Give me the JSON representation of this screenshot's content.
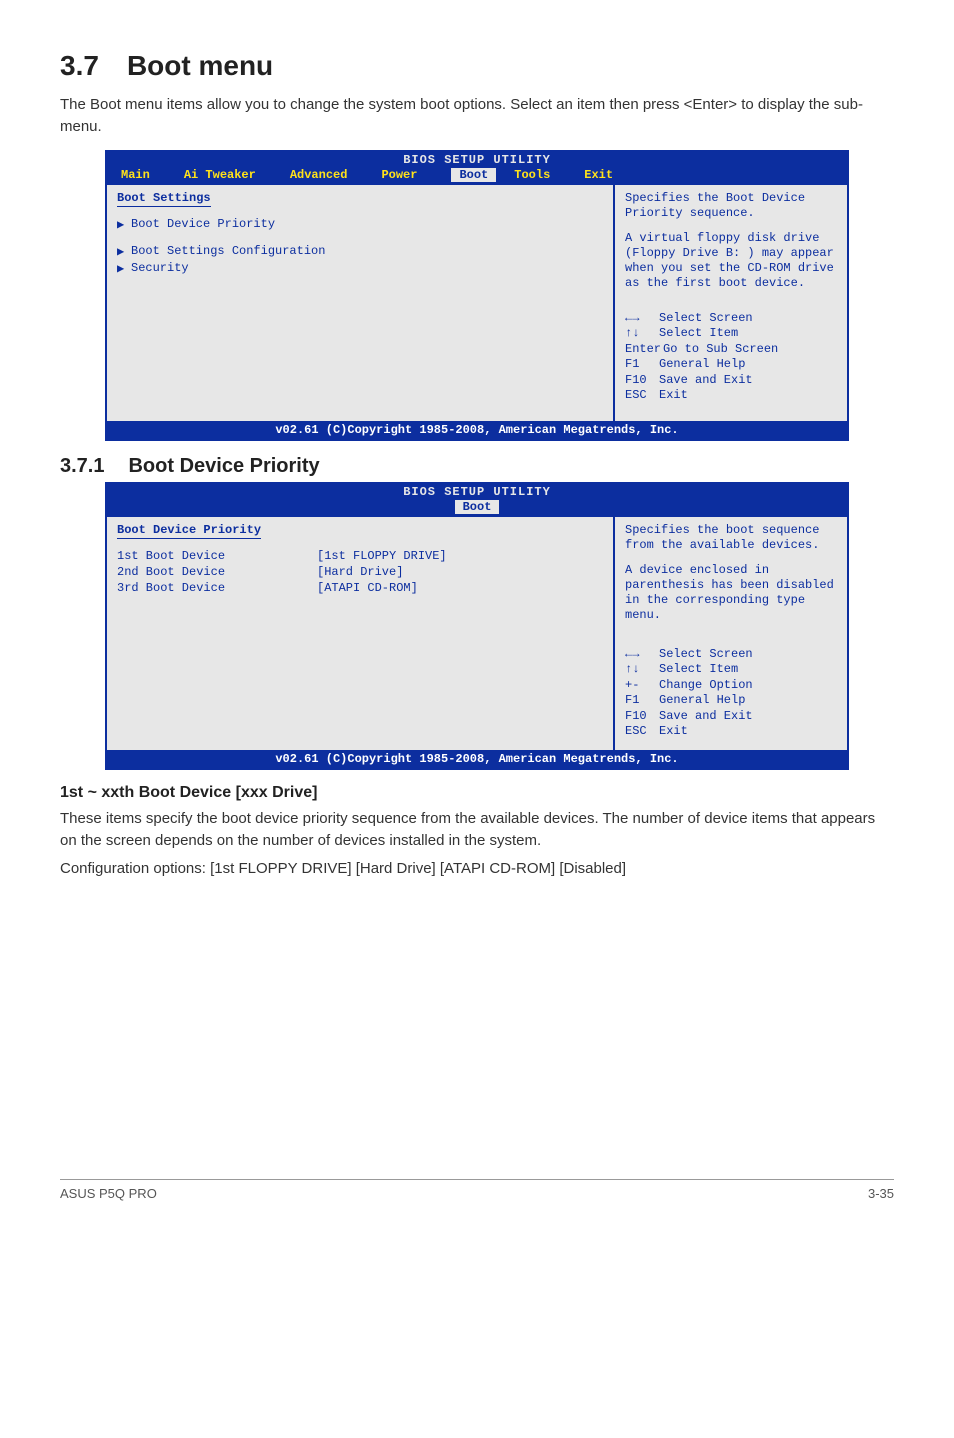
{
  "section": {
    "number": "3.7",
    "title": "Boot menu"
  },
  "intro": "The Boot menu items allow you to change the system boot options. Select an item then press <Enter> to display the sub-menu.",
  "bios1": {
    "title": "BIOS SETUP UTILITY",
    "tabs": [
      "Main",
      "Ai Tweaker",
      "Advanced",
      "Power",
      "Boot",
      "Tools",
      "Exit"
    ],
    "active_tab": "Boot",
    "heading": "Boot Settings",
    "items": [
      "Boot Device Priority",
      "Boot Settings Configuration",
      "Security"
    ],
    "help1": "Specifies the Boot Device Priority sequence.",
    "help2": "A virtual floppy disk drive (Floppy Drive B: ) may appear when you set the CD-ROM drive as the first boot device.",
    "keys": [
      {
        "glyph": "←→",
        "text": "Select Screen"
      },
      {
        "glyph": "↑↓",
        "text": "Select Item"
      },
      {
        "glyph": "Enter",
        "text": "Go to Sub Screen"
      },
      {
        "glyph": "F1",
        "text": "General Help"
      },
      {
        "glyph": "F10",
        "text": "Save and Exit"
      },
      {
        "glyph": "ESC",
        "text": "Exit"
      }
    ],
    "footer": "v02.61 (C)Copyright 1985-2008, American Megatrends, Inc."
  },
  "subsection": {
    "number": "3.7.1",
    "title": "Boot Device Priority"
  },
  "bios2": {
    "title": "BIOS SETUP UTILITY",
    "active_tab_only": "Boot",
    "heading": "Boot Device Priority",
    "rows": [
      {
        "label": "1st Boot Device",
        "value": "[1st FLOPPY DRIVE]"
      },
      {
        "label": "2nd Boot Device",
        "value": "[Hard Drive]"
      },
      {
        "label": "3rd Boot Device",
        "value": "[ATAPI CD-ROM]"
      }
    ],
    "help1": "Specifies the boot sequence from the available devices.",
    "help2": "A device enclosed in parenthesis has been disabled in the corresponding type menu.",
    "keys": [
      {
        "glyph": "←→",
        "text": "Select Screen"
      },
      {
        "glyph": "↑↓",
        "text": "Select Item"
      },
      {
        "glyph": "+-",
        "text": "Change Option"
      },
      {
        "glyph": "F1",
        "text": "General Help"
      },
      {
        "glyph": "F10",
        "text": "Save and Exit"
      },
      {
        "glyph": "ESC",
        "text": "Exit"
      }
    ],
    "footer": "v02.61 (C)Copyright 1985-2008, American Megatrends, Inc."
  },
  "field_title": "1st ~ xxth Boot Device [xxx Drive]",
  "body1": "These items specify the boot device priority sequence from the available devices. The number of device items that appears on the screen depends on the number of devices installed in the system.",
  "body2": "Configuration options: [1st FLOPPY DRIVE] [Hard Drive] [ATAPI CD-ROM] [Disabled]",
  "page_footer_left": "ASUS P5Q PRO",
  "page_footer_right": "3-35"
}
